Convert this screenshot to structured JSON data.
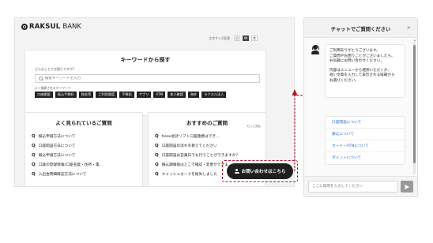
{
  "bank_page": {
    "logo": {
      "bold": "RAKSUL",
      "light": "BANK"
    },
    "font_size": {
      "label": "文字サイズ変更",
      "options": [
        "小",
        "中",
        "大"
      ],
      "selected": "中"
    },
    "search": {
      "title": "キーワードから探す",
      "prompt": "どんなことでお困りですか?",
      "placeholder": "検索キーワードを入力",
      "popular_label": "よく検索されるキーワード",
      "tags": [
        "口座開設",
        "振込手数料",
        "税金等",
        "ご利用限度",
        "手数料",
        "アプリ",
        "ATM",
        "本人確認",
        "海外",
        "ラクスル法人"
      ]
    },
    "faq_left": {
      "title": "よく見られているご質問",
      "items": [
        "振込申請方法について",
        "口座開設方法について",
        "振込申請方法について",
        "口座の登録情報(口座名義・住所・電...",
        "入出金明細確認方法について"
      ]
    },
    "faq_right": {
      "title": "おすすめのご質問",
      "more": "もっと見る",
      "items": [
        "freee会計ソフト口座連携はでき...",
        "口座開設の流れを教えてください",
        "口座開設は営業日でも行うことができますか?",
        "振込期限後はどこで確認・変更ができま...",
        "キャッシュカードを紛失しました"
      ]
    },
    "contact_button": "お問い合わせはこちら"
  },
  "chat": {
    "title": "チャットでご質問ください",
    "close_symbol": "×",
    "greeting_lines": [
      "ご利用ありがとうございます。",
      "ご質問やお困りごとがございましたら、",
      "お気軽にお問い合わせください。"
    ],
    "instruction_lines": [
      "内容はメニューから選択いただくか、",
      "短い文章を入力して表示される候補から",
      "お選びください。"
    ],
    "menu": [
      "口座開設について",
      "振込について",
      "カード・ATMについて",
      "ポイントについて"
    ],
    "input_placeholder": "ここに質問を入力してください",
    "colors": {
      "link": "#2a6ecf",
      "highlight": "#b4162e",
      "button_dark": "#1f1f1f"
    }
  }
}
